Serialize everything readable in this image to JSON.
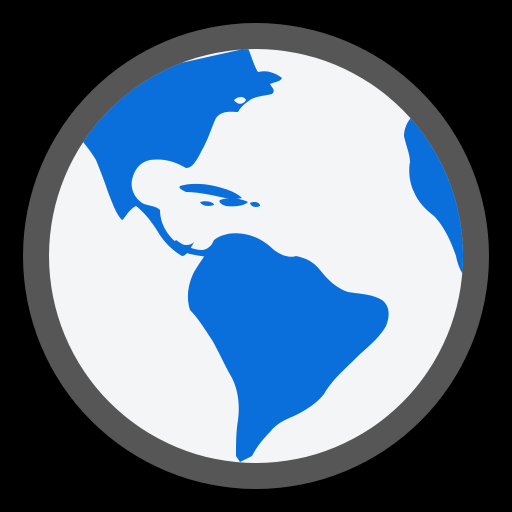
{
  "icon": {
    "name": "globe-icon",
    "colors": {
      "background": "#000000",
      "ring": "#565656",
      "ocean": "#f4f5f6",
      "land": "#0a6edb"
    }
  }
}
